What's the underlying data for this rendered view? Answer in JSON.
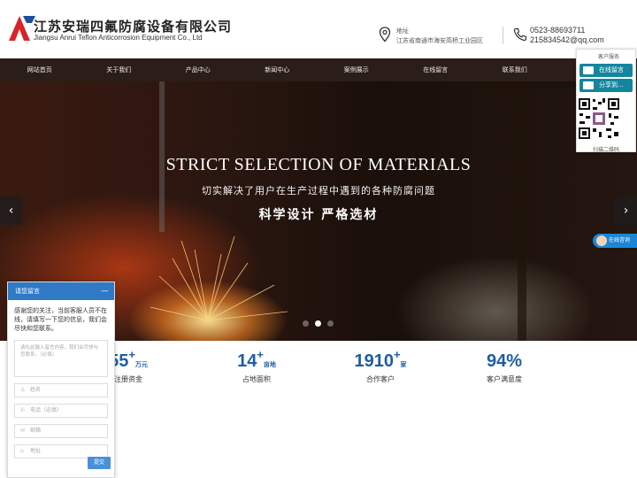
{
  "header": {
    "company_cn": "江苏安瑞四氟防腐设备有限公司",
    "company_en": "Jiangsu Anrui Teflon Anticorrosion Equipment Co., Ltd",
    "address_label": "地址",
    "address": "江苏省南通市海安高桥工业园区",
    "phone": "0523-88693711",
    "email": "215834542@qq.com"
  },
  "nav": [
    "网站首页",
    "关于我们",
    "产品中心",
    "新闻中心",
    "案例展示",
    "在线留言",
    "联系我们",
    ""
  ],
  "banner": {
    "title": "STRICT SELECTION OF MATERIALS",
    "subtitle": "切实解决了用户在生产过程中遇到的各种防腐问题",
    "tagline": "科学设计 严格选材",
    "prev": "‹",
    "next": "›",
    "slides": 3,
    "active_slide": 2
  },
  "stats": [
    {
      "num": "55",
      "plus": "+",
      "unit": "万元",
      "label": "注册资金"
    },
    {
      "num": "14",
      "plus": "+",
      "unit": "亩地",
      "label": "占地面积"
    },
    {
      "num": "1910",
      "plus": "+",
      "unit": "家",
      "label": "合作客户"
    },
    {
      "num": "94%",
      "plus": "",
      "unit": "",
      "label": "客户满意度"
    }
  ],
  "float_panel": {
    "title": "客户服务",
    "btn_message": "在线留言",
    "btn_share": "分享到...",
    "qr_caption": "扫描二维码"
  },
  "online_tab": "在线咨询",
  "chat": {
    "title": "请您留言",
    "minimize": "—",
    "message": "感谢您的关注，当前客服人员不在线，请填写一下您的信息，我们会尽快和您联系。",
    "textarea_placeholder": "请在此输入留言内容，我们会尽快与您联系。（必填）",
    "name_placeholder": "姓名",
    "phone_placeholder": "电话（必填）",
    "email_placeholder": "邮箱",
    "address_placeholder": "地址",
    "submit": "提交"
  },
  "colors": {
    "nav_bg": "#2b1d17",
    "accent_blue": "#1f5da5",
    "float_btn": "#13869e",
    "chat_head": "#2f79c5"
  }
}
